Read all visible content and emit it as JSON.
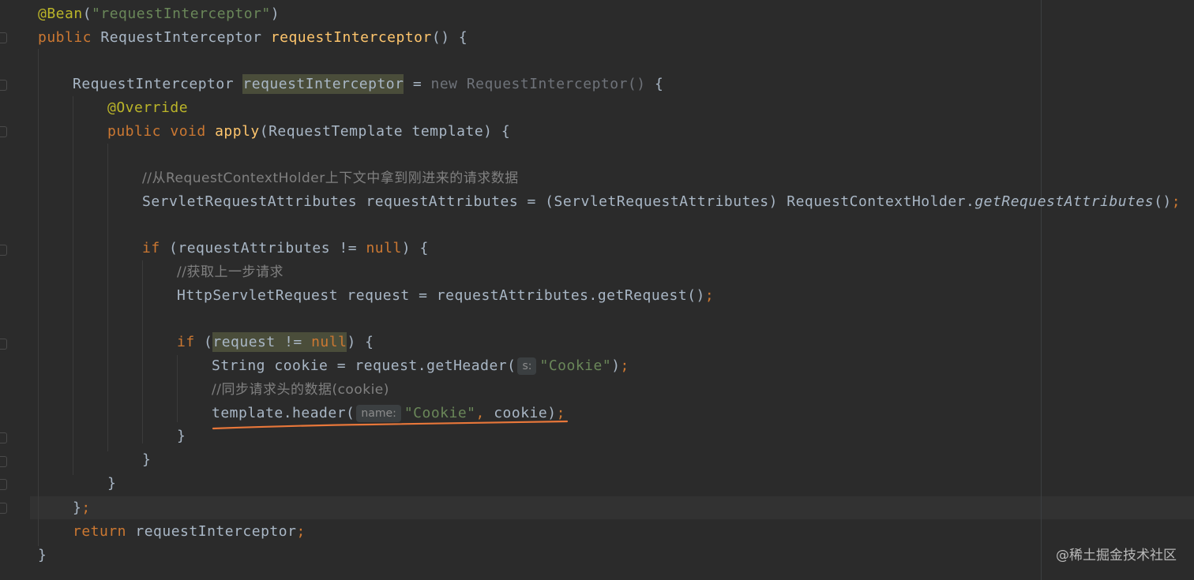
{
  "code": {
    "l1_annotation": "@Bean",
    "l1_paren_open": "(",
    "l1_string": "\"requestInterceptor\"",
    "l1_paren_close": ")",
    "l2_public": "public",
    "l2_type": " RequestInterceptor ",
    "l2_method": "requestInterceptor",
    "l2_rest": "() {",
    "l4_type": "RequestInterceptor ",
    "l4_var": "requestInterceptor",
    "l4_eq": " = ",
    "l4_new": "new RequestInterceptor() ",
    "l4_brace": "{",
    "l5_override": "@Override",
    "l6_public": "public",
    "l6_void": " void ",
    "l6_method": "apply",
    "l6_rest": "(RequestTemplate template) {",
    "l8_comment": "//从RequestContextHolder上下文中拿到刚进来的请求数据",
    "l9_code": "ServletRequestAttributes requestAttributes = (ServletRequestAttributes) RequestContextHolder.",
    "l9_italic": "getRequestAttributes",
    "l9_end": "()",
    "l9_semi": ";",
    "l11_if": "if",
    "l11_mid": " (requestAttributes != ",
    "l11_null": "null",
    "l11_end": ") {",
    "l12_comment": "//获取上一步请求",
    "l13_code": "HttpServletRequest request = requestAttributes.getRequest()",
    "l13_semi": ";",
    "l15_if": "if",
    "l15_paren": " (",
    "l15_hl_a": "request != ",
    "l15_null": "null",
    "l15_end": ") {",
    "l16_code": "String cookie = request.getHeader(",
    "l16_hint": "s:",
    "l16_str": "\"Cookie\"",
    "l16_close": ")",
    "l16_semi": ";",
    "l17_comment": "//同步请求头的数据(cookie)",
    "l18_code": "template.header(",
    "l18_hint": "name:",
    "l18_str": "\"Cookie\"",
    "l18_comma": ", ",
    "l18_arg": "cookie)",
    "l18_semi": ";",
    "l19_brace": "}",
    "l20_brace": "}",
    "l21_brace": "}",
    "l22_brace": "}",
    "l22_semi": ";",
    "l23_return": "return",
    "l23_rest": " requestInterceptor",
    "l23_semi": ";",
    "l24_brace": "}"
  },
  "watermark": "@稀土掘金技术社区",
  "colors": {
    "background": "#2b2b2b",
    "keyword": "#cc7832",
    "annotation": "#bbb529",
    "string": "#6a8759",
    "method": "#ffc66d",
    "comment": "#808080",
    "default": "#a9b7c6",
    "underline": "#e8773a"
  }
}
